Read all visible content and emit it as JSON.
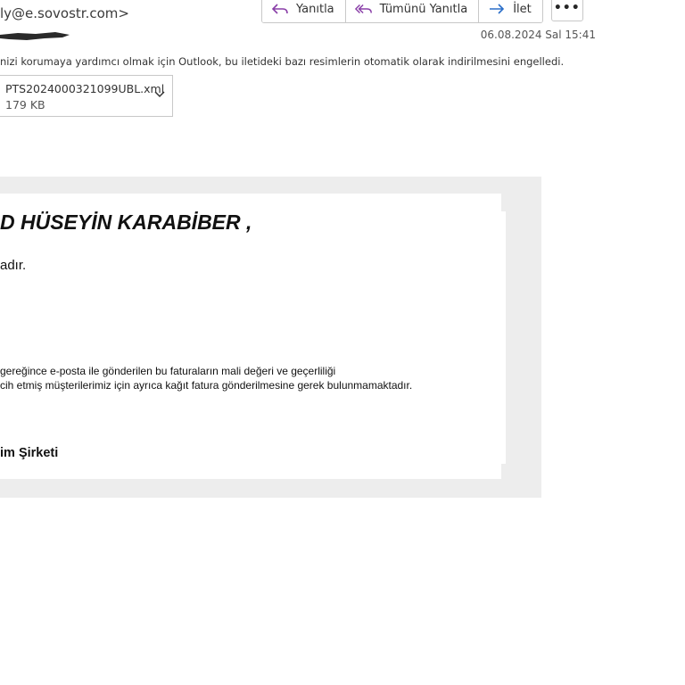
{
  "header": {
    "sender_email": "ly@e.sovostr.com>",
    "date": "06.08.2024 Sal 15:41"
  },
  "toolbar": {
    "reply_label": "Yanıtla",
    "reply_all_label": "Tümünü Yanıtla",
    "forward_label": "İlet",
    "more_label": "•••"
  },
  "notice": "nizi korumaya yardımcı olmak için Outlook, bu iletideki bazı resimlerin otomatik olarak indirilmesini engelledi.",
  "attachment": {
    "name": "PTS2024000321099UBL.xml",
    "size": "179 KB"
  },
  "body": {
    "greeting": "D HÜSEYİN  KARABİBER ,",
    "line1": "adır.",
    "para_line1": "gereğince e-posta ile gönderilen bu faturaların mali değeri ve geçerliliği",
    "para_line2": "cih etmiş müşterilerimiz için ayrıca kağıt fatura gönderilmesine gerek bulunmamaktadır.",
    "signature": "im Şirketi"
  },
  "colors": {
    "reply_icon": "#8a3fa8",
    "forward_icon": "#2b6fc9",
    "frame_bg": "#ededed"
  }
}
